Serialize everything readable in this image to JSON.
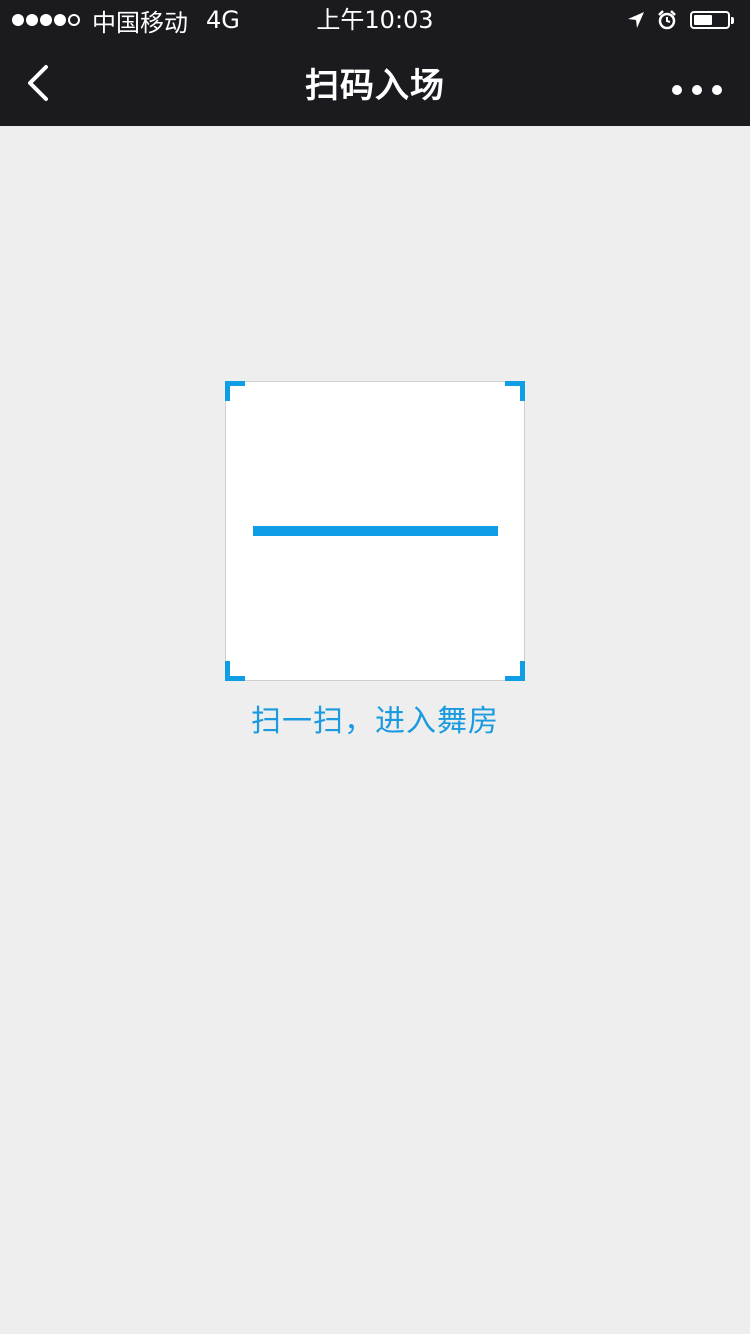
{
  "status_bar": {
    "signal_full": 4,
    "signal_total": 5,
    "carrier": "中国移动",
    "network": "4G",
    "time": "上午10:03",
    "icons": [
      "location-arrow-icon",
      "alarm-clock-icon",
      "battery-icon"
    ],
    "battery_level": 0.55
  },
  "nav": {
    "title": "扫码入场",
    "back_icon": "chevron-left-icon",
    "more_icon": "more-dots-icon"
  },
  "scanner": {
    "hint": "扫一扫，进入舞房",
    "accent_color": "#0f9ee6"
  },
  "colors": {
    "bar_background": "#1b1b1f",
    "page_background": "#eeeeee",
    "accent": "#0f9ee6"
  }
}
